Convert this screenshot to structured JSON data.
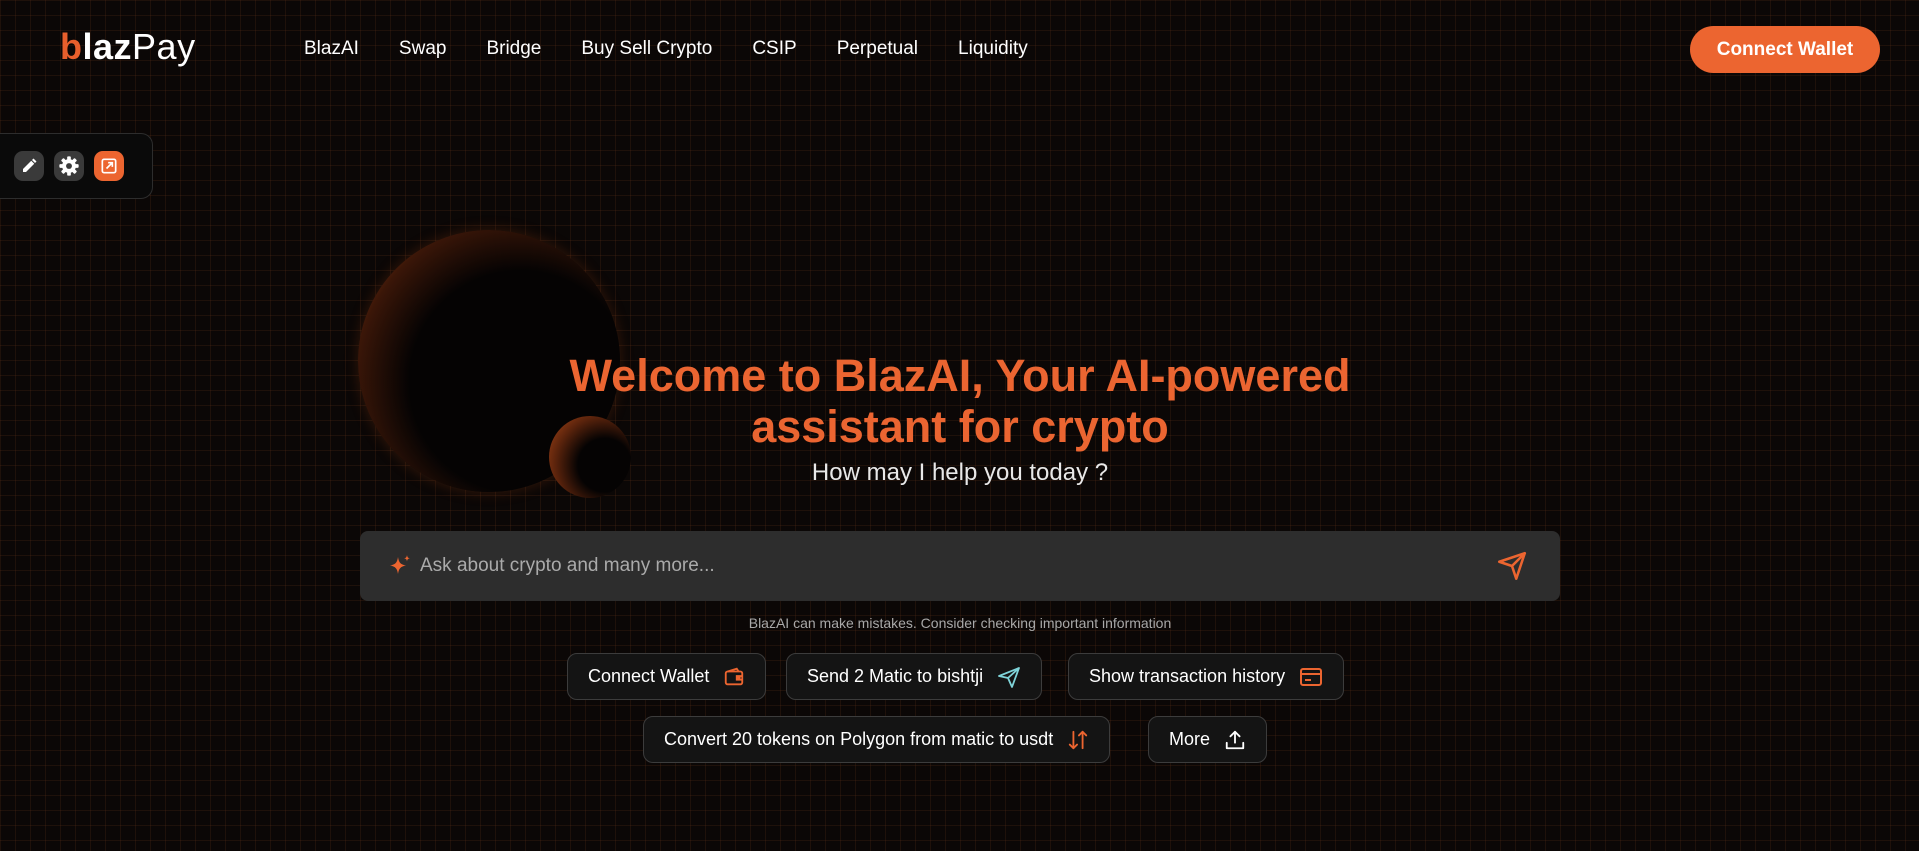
{
  "logo": {
    "part1": "b",
    "part2": "laz",
    "part3": "Pay"
  },
  "nav": {
    "items": [
      "BlazAI",
      "Swap",
      "Bridge",
      "Buy Sell Crypto",
      "CSIP",
      "Perpetual",
      "Liquidity"
    ]
  },
  "header": {
    "connect_wallet_label": "Connect Wallet"
  },
  "tools": {
    "icons": [
      "pencil-icon",
      "gear-icon",
      "external-link-icon"
    ]
  },
  "hero": {
    "title_line1": "Welcome to BlazAI, Your AI-powered",
    "title_line2": "assistant for crypto",
    "subtitle": "How may I help you today ?"
  },
  "chat": {
    "placeholder": "Ask about crypto and many more...",
    "disclaimer": "BlazAI can make mistakes. Consider checking important information"
  },
  "suggestions": [
    {
      "label": "Connect Wallet",
      "icon": "wallet-icon"
    },
    {
      "label": "Send 2 Matic to bishtji",
      "icon": "send-icon"
    },
    {
      "label": "Show transaction history",
      "icon": "card-icon"
    },
    {
      "label": "Convert 20 tokens on Polygon from matic to usdt",
      "icon": "swap-arrows-icon"
    },
    {
      "label": "More",
      "icon": "upload-icon"
    }
  ],
  "colors": {
    "accent": "#ec6530",
    "background": "#0b0706",
    "input_bg": "#2d2d2d",
    "send_icon": "#7fd4d9"
  }
}
